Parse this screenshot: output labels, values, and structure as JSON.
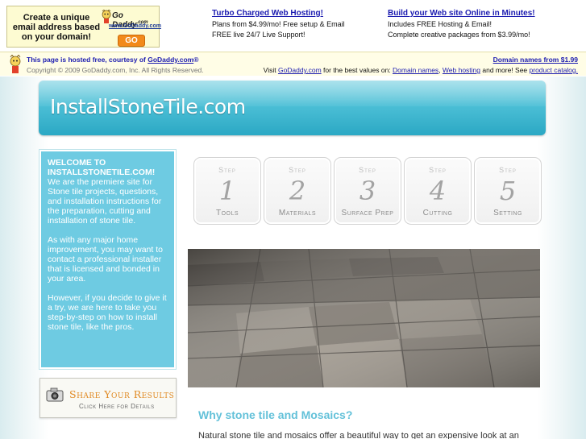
{
  "ad": {
    "banner_text": "Create a unique email address based on your domain!",
    "banner_brand": "Go Daddy",
    "banner_brand_suffix": ".com",
    "banner_url": "www.GoDaddy.com",
    "banner_button": "GO",
    "col1": {
      "title": "Turbo Charged Web Hosting!",
      "line1": "Plans from $4.99/mo! Free setup & Email",
      "line2": "FREE live 24/7 Live Support!"
    },
    "col2": {
      "title": "Build your Web site Online in Minutes!",
      "line1": "Includes FREE Hosting & Email!",
      "line2": "Complete creative packages from $3.99/mo!"
    }
  },
  "hosted": {
    "line1_prefix": "This page is hosted free, courtesy of ",
    "line1_link": "GoDaddy.com",
    "line1_suffix": "®",
    "copyright": "Copyright © 2009 GoDaddy.com, Inc. All Rights Reserved.",
    "right_link": "Domain names from $1.99",
    "r2_visit": "Visit ",
    "r2_godaddy": "GoDaddy.com",
    "r2_mid": " for the best values on: ",
    "r2_domains": "Domain names",
    "r2_comma": ", ",
    "r2_hosting": "Web hosting",
    "r2_more": " and more! See ",
    "r2_catalog": "product catalog."
  },
  "site": {
    "title": "InstallStoneTile.com"
  },
  "welcome": {
    "title": "WELCOME TO INSTALLSTONETILE.COM!",
    "p1": "We are the premiere site for Stone tile projects, questions, and installation instructions for the preparation, cutting and installation of stone tile.",
    "p2": "As with any major home improvement, you may want to contact a professional installer that is licensed and bonded in your area.",
    "p3": "However, if you decide to give it a try, we are here to take you step-by-step on how to install stone tile, like the pros."
  },
  "share": {
    "title": "Share Your Results",
    "subtitle": "Click Here for Details"
  },
  "steps": [
    {
      "label": "Step",
      "number": "1",
      "name": "Tools"
    },
    {
      "label": "Step",
      "number": "2",
      "name": "Materials"
    },
    {
      "label": "Step",
      "number": "3",
      "name": "Surface Prep"
    },
    {
      "label": "Step",
      "number": "4",
      "name": "Cutting"
    },
    {
      "label": "Step",
      "number": "5",
      "name": "Setting"
    }
  ],
  "content": {
    "heading": "Why stone tile and Mosaics?",
    "body": "Natural stone tile and mosaics offer  a beautiful way to get an expensive look at an"
  }
}
